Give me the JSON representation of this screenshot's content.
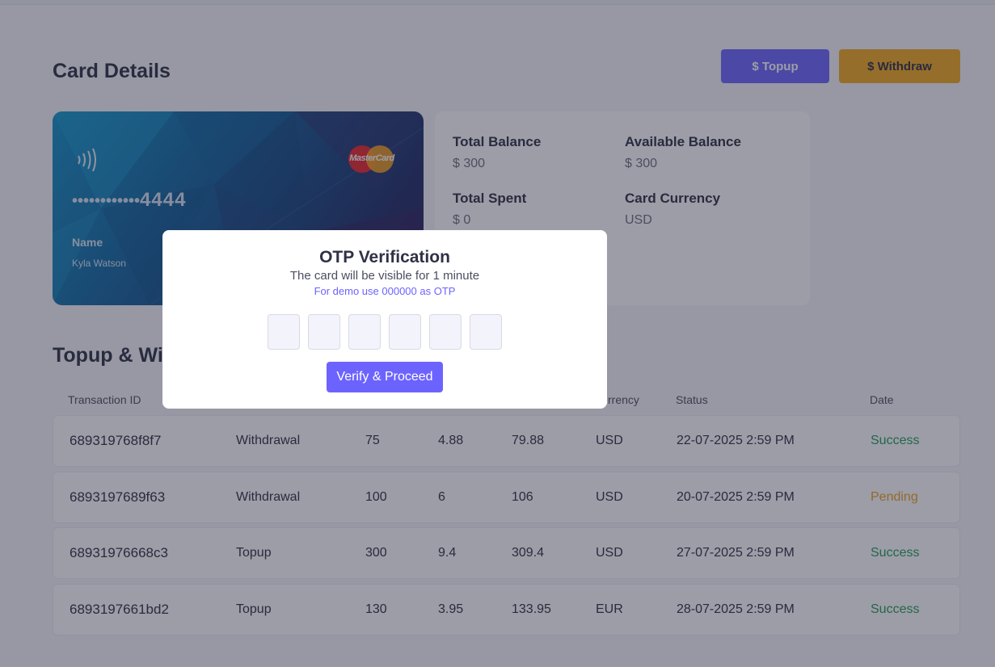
{
  "page": {
    "title": "Card Details",
    "topup_label": "$ Topup",
    "withdraw_label": "$ Withdraw"
  },
  "card": {
    "masked_digits": "••••••••••••",
    "last4": "4444",
    "name_label": "Name",
    "holder_name": "Kyla Watson",
    "brand": "MasterCard",
    "icons": [
      "contactless-icon",
      "mastercard-logo"
    ]
  },
  "balances": {
    "total_balance_label": "Total Balance",
    "total_balance": "$ 300",
    "available_balance_label": "Available Balance",
    "available_balance": "$ 300",
    "total_spent_label": "Total Spent",
    "total_spent": "$ 0",
    "currency_label": "Card Currency",
    "currency": "USD"
  },
  "transactions": {
    "title": "Topup & Withdrawals",
    "visible_title": "Topup & Wi",
    "headers": [
      "Transaction ID",
      "",
      "",
      "",
      "",
      "rrency",
      "Status",
      "Date"
    ],
    "rows": [
      [
        "689319768f8f7",
        "Withdrawal",
        "75",
        "4.88",
        "79.88",
        "USD",
        "22-07-2025 2:59 PM",
        "Success"
      ],
      [
        "6893197689f63",
        "Withdrawal",
        "100",
        "6",
        "106",
        "USD",
        "20-07-2025 2:59 PM",
        "Pending"
      ],
      [
        "68931976668c3",
        "Topup",
        "300",
        "9.4",
        "309.4",
        "USD",
        "27-07-2025 2:59 PM",
        "Success"
      ],
      [
        "6893197661bd2",
        "Topup",
        "130",
        "3.95",
        "133.95",
        "EUR",
        "28-07-2025 2:59 PM",
        "Success"
      ]
    ]
  },
  "modal": {
    "title": "OTP Verification",
    "subtitle": "The card will be visible for 1 minute",
    "hint": "For demo use 000000 as OTP",
    "otp_digits": [
      "",
      "",
      "",
      "",
      "",
      ""
    ],
    "button_label": "Verify & Proceed"
  },
  "colors": {
    "accent": "#6c63ff",
    "warning": "#f4a81d",
    "success": "#1f9d55",
    "pending": "#f0a020"
  }
}
